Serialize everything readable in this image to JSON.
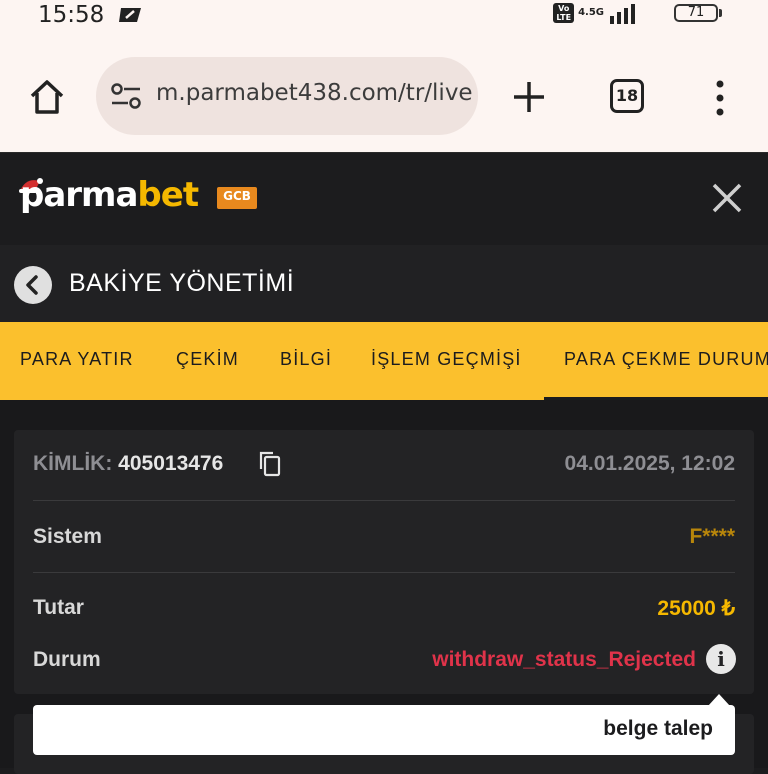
{
  "status_bar": {
    "time": "15:58",
    "volte": "Vo\nLTE",
    "network": "4.5G",
    "battery": "71"
  },
  "browser": {
    "url": "m.parmabet438.com/tr/live",
    "tab_count": "18"
  },
  "site": {
    "logo_part1": "parma",
    "logo_part2": "bet",
    "badge": "GCB",
    "colors": {
      "brand_yellow": "#fbc02d",
      "logo_yellow": "#f5b800",
      "amount": "#f5b800",
      "rejected": "#e0334a"
    }
  },
  "page": {
    "title": "BAKİYE YÖNETİMİ"
  },
  "tabs": [
    {
      "label": "PARA YATIR"
    },
    {
      "label": "ÇEKİM"
    },
    {
      "label": "BİLGİ"
    },
    {
      "label": "İŞLEM GEÇMİŞİ"
    },
    {
      "label": "PARA ÇEKME DURUMU",
      "active": true
    }
  ],
  "withdrawal": {
    "id_label": "KİMLİK:",
    "id_value": "405013476",
    "date": "04.01.2025, 12:02",
    "system_label": "Sistem",
    "system_value": "F****",
    "amount_label": "Tutar",
    "amount_value": "25000 ₺",
    "status_label": "Durum",
    "status_value": "withdraw_status_Rejected"
  },
  "tooltip": {
    "text": "belge talep"
  }
}
